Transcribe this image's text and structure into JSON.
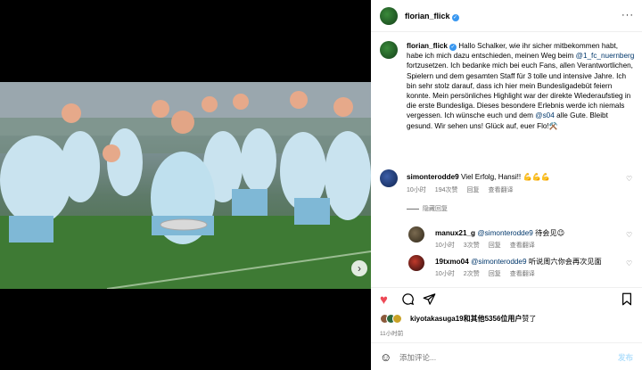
{
  "post": {
    "author": "florian_flick",
    "caption_parts": {
      "p1": "Hallo Schalker, wie ihr sicher mitbekommen habt, habe ich mich dazu entschieden, meinen Weg beim ",
      "mention1": "@1_fc_nuernberg",
      "p2": " fortzusetzen. Ich bedanke mich bei euch Fans, allen Verantwortlichen, Spielern und dem gesamten Staff für 3 tolle und intensive Jahre. Ich bin sehr stolz darauf, dass ich hier mein Bundesligadebüt feiern konnte. Mein persönliches Highlight war der direkte Wiederaufstieg in die erste Bundesliga. Dieses besondere Erlebnis werde ich niemals vergessen. Ich wünsche euch und dem ",
      "mention2": "@s04",
      "p3": " alle Gute. Bleibt gesund. Wir sehen uns! Glück auf, euer Flo!⚒️"
    },
    "likes_prefix": "kiyotakasuga19和",
    "likes_count": "其他5356位用户",
    "likes_suffix": "赞了",
    "time": "11小时前"
  },
  "comments": [
    {
      "user": "simonterodde9",
      "text": "Viel Erfolg, Hansi!! 💪💪💪",
      "time": "10小时",
      "likes": "194次赞",
      "reply": "回复",
      "translate": "查看翻译"
    }
  ],
  "replies_toggle": "隐藏回复",
  "replies": [
    {
      "user": "manux21_g",
      "mention": "@simonterodde9",
      "text": " 待会见😉",
      "time": "10小时",
      "likes": "3次赞",
      "reply": "回复",
      "translate": "查看翻译"
    },
    {
      "user": "19txmo04",
      "mention": "@simonterodde9",
      "text": " 听说周六你会再次见面",
      "time": "10小时",
      "likes": "2次赞",
      "reply": "回复",
      "translate": "查看翻译"
    }
  ],
  "add_comment": {
    "placeholder": "添加评论...",
    "post_label": "发布"
  },
  "icons": {
    "verified": "verified-badge-icon",
    "more": "more-options-icon",
    "like": "heart-icon",
    "comment": "comment-icon",
    "share": "share-icon",
    "save": "bookmark-icon",
    "emoji": "emoji-icon"
  },
  "colors": {
    "like_red": "#ed4956",
    "link_blue": "#00376b",
    "verified_blue": "#3897f0"
  }
}
